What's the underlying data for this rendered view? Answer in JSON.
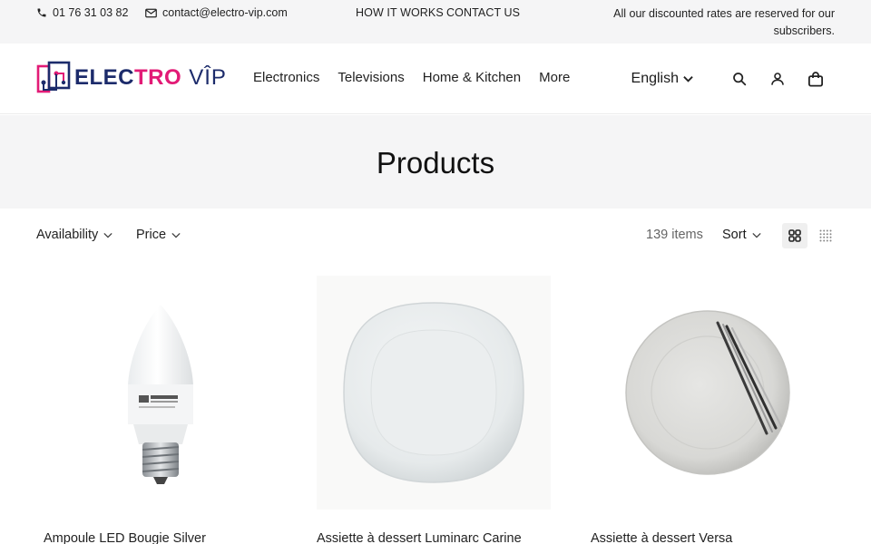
{
  "topbar": {
    "phone": "01 76 31 03 82",
    "email": "contact@electro-vip.com",
    "links": [
      "HOW IT WORKS",
      "CONTACT US"
    ],
    "promo": "All our discounted rates are reserved for our subscribers."
  },
  "header": {
    "logo": {
      "part1": "ELEC",
      "part2": "TRO",
      "part3": "VÎP"
    },
    "nav": [
      "Electronics",
      "Televisions",
      "Home & Kitchen",
      "More"
    ],
    "language": "English",
    "icons": [
      "search-icon",
      "account-icon",
      "cart-icon"
    ]
  },
  "page": {
    "title": "Products"
  },
  "toolbar": {
    "filters": [
      "Availability",
      "Price"
    ],
    "item_count": "139 items",
    "sort_label": "Sort",
    "views": [
      "grid-large-icon",
      "grid-small-icon"
    ]
  },
  "products": [
    {
      "title": "Ampoule LED Bougie Silver",
      "image": "led-bulb"
    },
    {
      "title": "Assiette à dessert Luminarc Carine",
      "image": "square-plate"
    },
    {
      "title": "Assiette à dessert Versa",
      "image": "round-plate"
    }
  ],
  "colors": {
    "brand_navy": "#1c2b6b",
    "brand_pink": "#e21b76",
    "band_bg": "#f5f5f6"
  }
}
